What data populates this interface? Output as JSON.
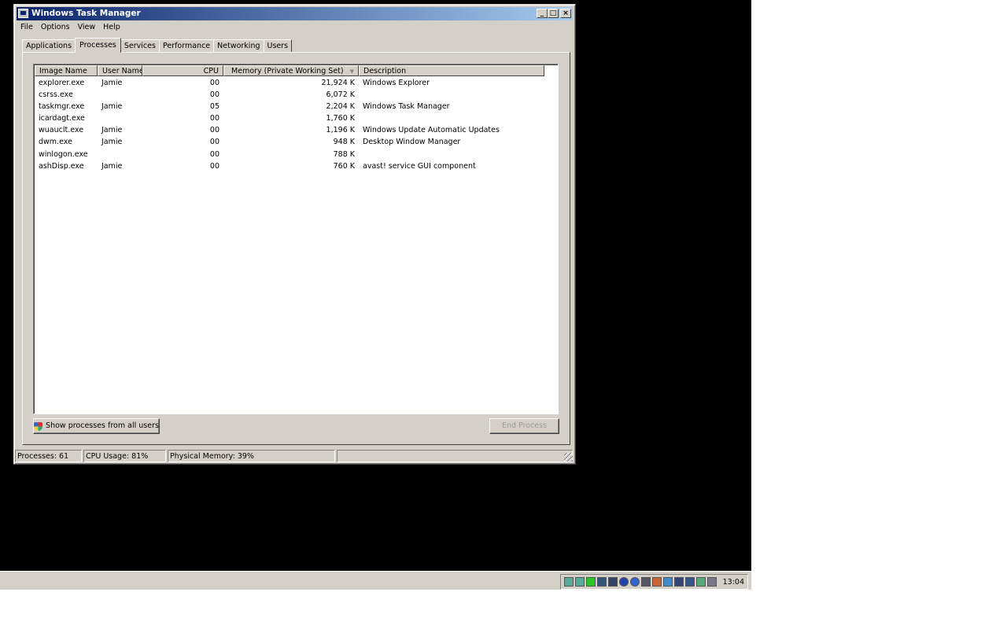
{
  "window": {
    "title": "Windows Task Manager"
  },
  "menu": [
    "File",
    "Options",
    "View",
    "Help"
  ],
  "tabs": [
    {
      "label": "Applications"
    },
    {
      "label": "Processes",
      "active": true
    },
    {
      "label": "Services"
    },
    {
      "label": "Performance"
    },
    {
      "label": "Networking"
    },
    {
      "label": "Users"
    }
  ],
  "columns": [
    "Image Name",
    "User Name",
    "CPU",
    "Memory (Private Working Set)",
    "Description"
  ],
  "sort_column": "Memory (Private Working Set)",
  "rows": [
    {
      "image": "explorer.exe",
      "user": "Jamie",
      "cpu": "00",
      "mem": "21,924 K",
      "desc": "Windows Explorer"
    },
    {
      "image": "csrss.exe",
      "user": "",
      "cpu": "00",
      "mem": "6,072 K",
      "desc": ""
    },
    {
      "image": "taskmgr.exe",
      "user": "Jamie",
      "cpu": "05",
      "mem": "2,204 K",
      "desc": "Windows Task Manager"
    },
    {
      "image": "icardagt.exe",
      "user": "",
      "cpu": "00",
      "mem": "1,760 K",
      "desc": ""
    },
    {
      "image": "wuauclt.exe",
      "user": "Jamie",
      "cpu": "00",
      "mem": "1,196 K",
      "desc": "Windows Update Automatic Updates"
    },
    {
      "image": "dwm.exe",
      "user": "Jamie",
      "cpu": "00",
      "mem": "948 K",
      "desc": "Desktop Window Manager"
    },
    {
      "image": "winlogon.exe",
      "user": "",
      "cpu": "00",
      "mem": "788 K",
      "desc": ""
    },
    {
      "image": "ashDisp.exe",
      "user": "Jamie",
      "cpu": "00",
      "mem": "760 K",
      "desc": "avast! service GUI component"
    }
  ],
  "buttons": {
    "show_all": "Show processes from all users",
    "end_process": "End Process"
  },
  "status": {
    "processes": "Processes: 61",
    "cpu": "CPU Usage: 81%",
    "memory": "Physical Memory: 39%"
  },
  "tray": {
    "time": "13:04",
    "icons": [
      "network-icon",
      "network-icon",
      "status-green-icon",
      "monitor-icon",
      "network-icon",
      "info-icon",
      "info-icon",
      "display-icon",
      "app-icon",
      "network-icon",
      "app-icon",
      "printer-icon",
      "network-icon",
      "volume-icon"
    ]
  },
  "colors": {
    "titlebar_start": "#0a246a",
    "titlebar_end": "#a6caf0",
    "face": "#d4d0c8",
    "desktop": "#000000"
  }
}
